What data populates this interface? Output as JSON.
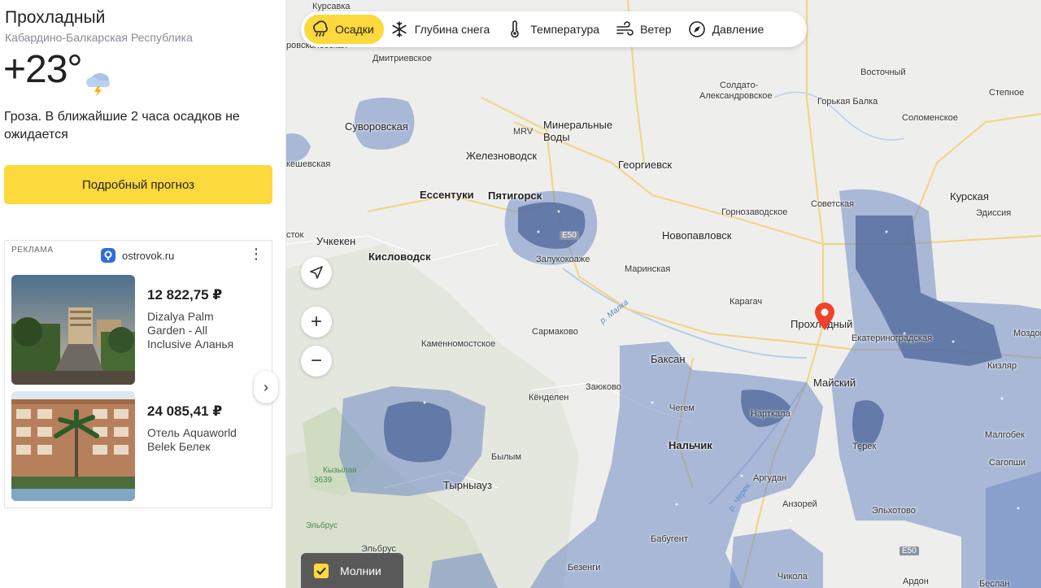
{
  "sidebar": {
    "city": "Прохладный",
    "region": "Кабардино-Балкарская Республика",
    "temperature": "+23°",
    "weather_icon": "thunderstorm-cloud-icon",
    "description": "Гроза. В ближайшие 2 часа осадков не ожидается",
    "forecast_button": "Подробный прогноз"
  },
  "ad": {
    "label": "РЕКЛАМА",
    "source": "ostrovok.ru",
    "items": [
      {
        "price": "12 822,75 ₽",
        "name": "Dizalya Palm Garden - All Inclusive Аланья"
      },
      {
        "price": "24 085,41 ₽",
        "name": "Отель Aquaworld Belek Белек"
      }
    ]
  },
  "map": {
    "layers": [
      {
        "label": "Осадки",
        "icon": "precipitation-icon",
        "active": true
      },
      {
        "label": "Глубина снега",
        "icon": "snowflake-icon",
        "active": false
      },
      {
        "label": "Температура",
        "icon": "thermometer-icon",
        "active": false
      },
      {
        "label": "Ветер",
        "icon": "wind-icon",
        "active": false
      },
      {
        "label": "Давление",
        "icon": "compass-icon",
        "active": false
      }
    ],
    "zoom_in": "+",
    "zoom_out": "−",
    "lightning_label": "Молнии",
    "lightning_checked": true,
    "places": {
      "kursavka": "Курсавка",
      "vorovskolesskaya": "ровсколесская",
      "dmitrievskoe": "Дмитриевское",
      "mrv": "MRV",
      "mineralnye": "Минеральные",
      "vody": "Воды",
      "suvorovskaya": "Суворовская",
      "zheleznovodsk": "Железноводск",
      "georgievsk": "Георгиевск",
      "soldato": "Солдато-",
      "aleksandrovskoe": "Александровское",
      "vostochny": "Восточный",
      "gorkaya_balka": "Горькая Балка",
      "stepnoe": "Степное",
      "solomenskoe": "Соломенское",
      "eshkeshevskaya": "кешевская",
      "essentuki": "Ессентуки",
      "pyatigorsk": "Пятигорск",
      "gornozavodskoe": "Горнозаводское",
      "sovetskaya": "Советская",
      "kurskaya": "Курская",
      "edissiya": "Эдиссия",
      "stok": "сток",
      "uchkeken": "Учкекен",
      "kislovodsk": "Кисловодск",
      "novopavlovsk": "Новопавловск",
      "zalukokoazhe": "Залукокоаже",
      "marinskaya": "Маринская",
      "karagach": "Карагач",
      "prokhladny": "Прохладный",
      "ekaterinogradskaya": "Екатериноградская",
      "mozdok": "Моздок",
      "kizlyar": "Кизляр",
      "sarmakovo": "Сармаково",
      "kamennomostskoe": "Каменномостское",
      "baksan": "Баксан",
      "maysky": "Майский",
      "zayukovo": "Заюково",
      "kendelen": "Кёнделен",
      "chegem": "Чегем",
      "nartkala": "Нарткала",
      "nalchik": "Нальчик",
      "terek": "Терек",
      "malgobek": "Малгобек",
      "sagopshi": "Сагопши",
      "bylym": "Былым",
      "tyrnyauz": "Тырныауз",
      "kyzylaya": "Кызылая",
      "kyzylaya_height": "3639",
      "argudan": "Аргудан",
      "anzorey": "Анзорей",
      "elkhotovo": "Эльхотово",
      "elbrus": "Эльбрус",
      "babugent": "Бабугент",
      "elbrus_village": "Эльбрус",
      "bezengi": "Безенги",
      "chikola": "Чикола",
      "ardon": "Ардон",
      "beslan": "Беслан",
      "river_malka": "р. Малка",
      "river_cherek": "р. Черек",
      "road_e50": "E50",
      "road_e50b": "E50"
    }
  }
}
